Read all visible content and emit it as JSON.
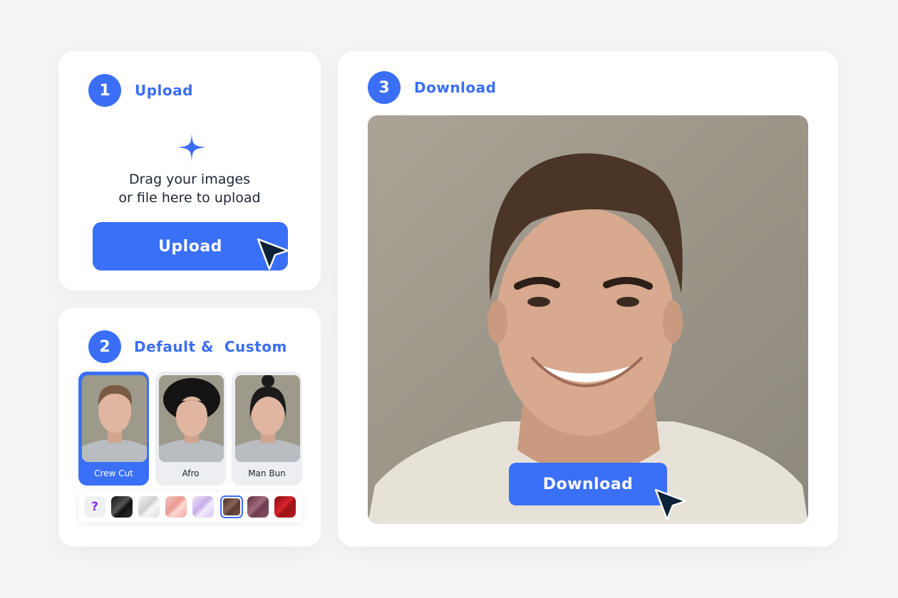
{
  "upload": {
    "step": "1",
    "title": "Upload",
    "hint_line1": "Drag your images",
    "hint_line2": "or file here to upload",
    "button": "Upload"
  },
  "styles": {
    "step": "2",
    "title": "Default &  Custom",
    "items": [
      {
        "label": "Crew Cut",
        "selected": true
      },
      {
        "label": "Afro",
        "selected": false
      },
      {
        "label": "Man Bun",
        "selected": false
      }
    ],
    "colors": [
      {
        "name": "custom",
        "symbol": "?"
      },
      {
        "name": "black",
        "color": "#222222"
      },
      {
        "name": "white",
        "color": "#e6e6e6"
      },
      {
        "name": "pink",
        "color": "#f2b3ae"
      },
      {
        "name": "lavender",
        "color": "#dccbf1"
      },
      {
        "name": "brown",
        "color": "#6b4a40",
        "selected": true
      },
      {
        "name": "mauve",
        "color": "#7d4a5c"
      },
      {
        "name": "red",
        "color": "#b3161d"
      }
    ]
  },
  "download": {
    "step": "3",
    "title": "Download",
    "button": "Download"
  },
  "colors": {
    "accent": "#3b6ef6",
    "background": "#f4f4f5",
    "cursor": "#0d2236"
  }
}
